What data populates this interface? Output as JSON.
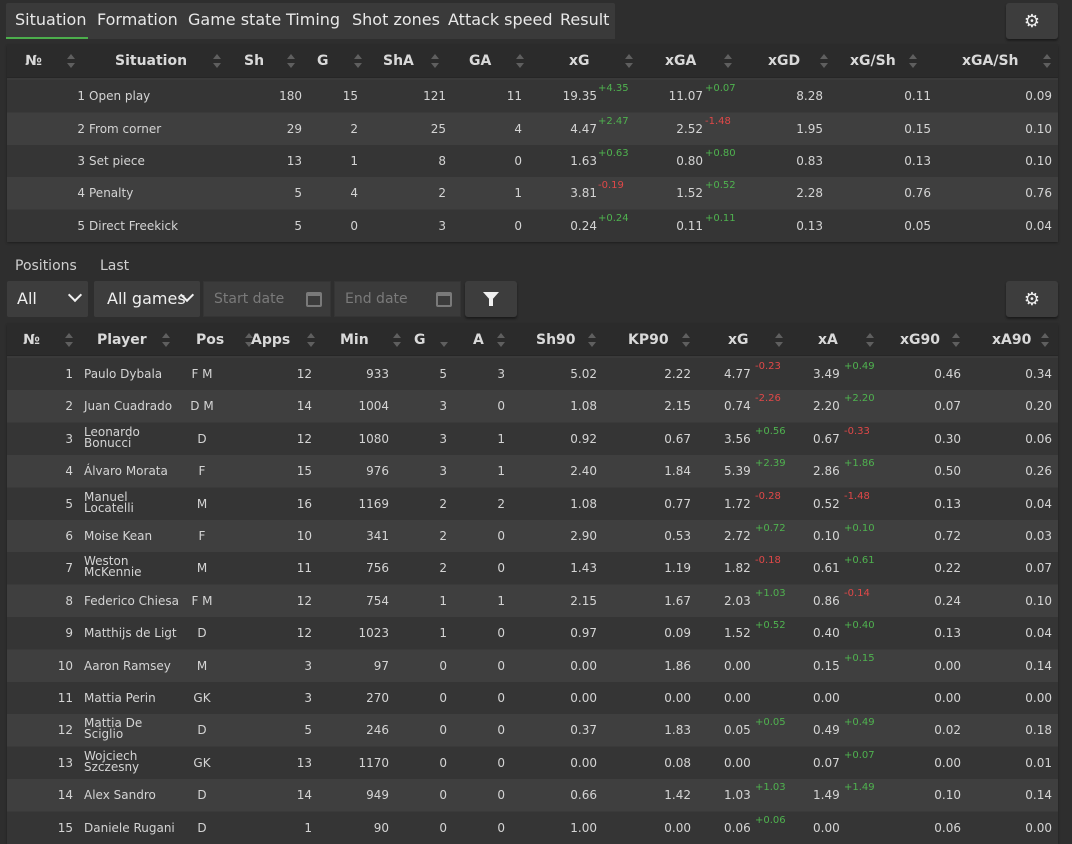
{
  "tabs": [
    "Situation",
    "Formation",
    "Game state",
    "Timing",
    "Shot zones",
    "Attack speed",
    "Result"
  ],
  "active_tab": "Situation",
  "situation_table": {
    "headers": [
      "№",
      "Situation",
      "Sh",
      "G",
      "ShA",
      "GA",
      "xG",
      "xGA",
      "xGD",
      "xG/Sh",
      "xGA/Sh"
    ],
    "rows": [
      {
        "n": "1",
        "situation": "Open play",
        "sh": "180",
        "g": "15",
        "sha": "121",
        "ga": "11",
        "xg": "19.35",
        "xg_diff": "+4.35",
        "xga": "11.07",
        "xga_diff": "+0.07",
        "xgd": "8.28",
        "xg_sh": "0.11",
        "xga_sh": "0.09"
      },
      {
        "n": "2",
        "situation": "From corner",
        "sh": "29",
        "g": "2",
        "sha": "25",
        "ga": "4",
        "xg": "4.47",
        "xg_diff": "+2.47",
        "xga": "2.52",
        "xga_diff": "-1.48",
        "xgd": "1.95",
        "xg_sh": "0.15",
        "xga_sh": "0.10"
      },
      {
        "n": "3",
        "situation": "Set piece",
        "sh": "13",
        "g": "1",
        "sha": "8",
        "ga": "0",
        "xg": "1.63",
        "xg_diff": "+0.63",
        "xga": "0.80",
        "xga_diff": "+0.80",
        "xgd": "0.83",
        "xg_sh": "0.13",
        "xga_sh": "0.10"
      },
      {
        "n": "4",
        "situation": "Penalty",
        "sh": "5",
        "g": "4",
        "sha": "2",
        "ga": "1",
        "xg": "3.81",
        "xg_diff": "-0.19",
        "xga": "1.52",
        "xga_diff": "+0.52",
        "xgd": "2.28",
        "xg_sh": "0.76",
        "xga_sh": "0.76"
      },
      {
        "n": "5",
        "situation": "Direct Freekick",
        "sh": "5",
        "g": "0",
        "sha": "3",
        "ga": "0",
        "xg": "0.24",
        "xg_diff": "+0.24",
        "xga": "0.11",
        "xga_diff": "+0.11",
        "xgd": "0.13",
        "xg_sh": "0.05",
        "xga_sh": "0.04"
      }
    ]
  },
  "filters": {
    "positions_label": "Positions",
    "last_label": "Last",
    "positions_value": "All",
    "last_value": "All games",
    "start_placeholder": "Start date",
    "end_placeholder": "End date"
  },
  "player_table": {
    "headers": [
      "№",
      "Player",
      "Pos",
      "Apps",
      "Min",
      "G",
      "A",
      "Sh90",
      "KP90",
      "xG",
      "xA",
      "xG90",
      "xA90"
    ],
    "rows": [
      {
        "n": "1",
        "name": "Paulo Dybala",
        "pos": "F M",
        "apps": "12",
        "min": "933",
        "g": "5",
        "a": "3",
        "sh90": "5.02",
        "kp90": "2.22",
        "xg": "4.77",
        "xg_diff": "-0.23",
        "xa": "3.49",
        "xa_diff": "+0.49",
        "xg90": "0.46",
        "xa90": "0.34"
      },
      {
        "n": "2",
        "name": "Juan Cuadrado",
        "pos": "D M",
        "apps": "14",
        "min": "1004",
        "g": "3",
        "a": "0",
        "sh90": "1.08",
        "kp90": "2.15",
        "xg": "0.74",
        "xg_diff": "-2.26",
        "xa": "2.20",
        "xa_diff": "+2.20",
        "xg90": "0.07",
        "xa90": "0.20"
      },
      {
        "n": "3",
        "name": "Leonardo Bonucci",
        "pos": "D",
        "apps": "12",
        "min": "1080",
        "g": "3",
        "a": "1",
        "sh90": "0.92",
        "kp90": "0.67",
        "xg": "3.56",
        "xg_diff": "+0.56",
        "xa": "0.67",
        "xa_diff": "-0.33",
        "xg90": "0.30",
        "xa90": "0.06"
      },
      {
        "n": "4",
        "name": "Álvaro Morata",
        "pos": "F",
        "apps": "15",
        "min": "976",
        "g": "3",
        "a": "1",
        "sh90": "2.40",
        "kp90": "1.84",
        "xg": "5.39",
        "xg_diff": "+2.39",
        "xa": "2.86",
        "xa_diff": "+1.86",
        "xg90": "0.50",
        "xa90": "0.26"
      },
      {
        "n": "5",
        "name": "Manuel Locatelli",
        "pos": "M",
        "apps": "16",
        "min": "1169",
        "g": "2",
        "a": "2",
        "sh90": "1.08",
        "kp90": "0.77",
        "xg": "1.72",
        "xg_diff": "-0.28",
        "xa": "0.52",
        "xa_diff": "-1.48",
        "xg90": "0.13",
        "xa90": "0.04"
      },
      {
        "n": "6",
        "name": "Moise Kean",
        "pos": "F",
        "apps": "10",
        "min": "341",
        "g": "2",
        "a": "0",
        "sh90": "2.90",
        "kp90": "0.53",
        "xg": "2.72",
        "xg_diff": "+0.72",
        "xa": "0.10",
        "xa_diff": "+0.10",
        "xg90": "0.72",
        "xa90": "0.03"
      },
      {
        "n": "7",
        "name": "Weston McKennie",
        "pos": "M",
        "apps": "11",
        "min": "756",
        "g": "2",
        "a": "0",
        "sh90": "1.43",
        "kp90": "1.19",
        "xg": "1.82",
        "xg_diff": "-0.18",
        "xa": "0.61",
        "xa_diff": "+0.61",
        "xg90": "0.22",
        "xa90": "0.07"
      },
      {
        "n": "8",
        "name": "Federico Chiesa",
        "pos": "F M",
        "apps": "12",
        "min": "754",
        "g": "1",
        "a": "1",
        "sh90": "2.15",
        "kp90": "1.67",
        "xg": "2.03",
        "xg_diff": "+1.03",
        "xa": "0.86",
        "xa_diff": "-0.14",
        "xg90": "0.24",
        "xa90": "0.10"
      },
      {
        "n": "9",
        "name": "Matthijs de Ligt",
        "pos": "D",
        "apps": "12",
        "min": "1023",
        "g": "1",
        "a": "0",
        "sh90": "0.97",
        "kp90": "0.09",
        "xg": "1.52",
        "xg_diff": "+0.52",
        "xa": "0.40",
        "xa_diff": "+0.40",
        "xg90": "0.13",
        "xa90": "0.04"
      },
      {
        "n": "10",
        "name": "Aaron Ramsey",
        "pos": "M",
        "apps": "3",
        "min": "97",
        "g": "0",
        "a": "0",
        "sh90": "0.00",
        "kp90": "1.86",
        "xg": "0.00",
        "xg_diff": "",
        "xa": "0.15",
        "xa_diff": "+0.15",
        "xg90": "0.00",
        "xa90": "0.14"
      },
      {
        "n": "11",
        "name": "Mattia Perin",
        "pos": "GK",
        "apps": "3",
        "min": "270",
        "g": "0",
        "a": "0",
        "sh90": "0.00",
        "kp90": "0.00",
        "xg": "0.00",
        "xg_diff": "",
        "xa": "0.00",
        "xa_diff": "",
        "xg90": "0.00",
        "xa90": "0.00"
      },
      {
        "n": "12",
        "name": "Mattia De Sciglio",
        "pos": "D",
        "apps": "5",
        "min": "246",
        "g": "0",
        "a": "0",
        "sh90": "0.37",
        "kp90": "1.83",
        "xg": "0.05",
        "xg_diff": "+0.05",
        "xa": "0.49",
        "xa_diff": "+0.49",
        "xg90": "0.02",
        "xa90": "0.18"
      },
      {
        "n": "13",
        "name": "Wojciech Szczesny",
        "pos": "GK",
        "apps": "13",
        "min": "1170",
        "g": "0",
        "a": "0",
        "sh90": "0.00",
        "kp90": "0.08",
        "xg": "0.00",
        "xg_diff": "",
        "xa": "0.07",
        "xa_diff": "+0.07",
        "xg90": "0.00",
        "xa90": "0.01"
      },
      {
        "n": "14",
        "name": "Alex Sandro",
        "pos": "D",
        "apps": "14",
        "min": "949",
        "g": "0",
        "a": "0",
        "sh90": "0.66",
        "kp90": "1.42",
        "xg": "1.03",
        "xg_diff": "+1.03",
        "xa": "1.49",
        "xa_diff": "+1.49",
        "xg90": "0.10",
        "xa90": "0.14"
      },
      {
        "n": "15",
        "name": "Daniele Rugani",
        "pos": "D",
        "apps": "1",
        "min": "90",
        "g": "0",
        "a": "0",
        "sh90": "1.00",
        "kp90": "0.00",
        "xg": "0.06",
        "xg_diff": "+0.06",
        "xa": "0.00",
        "xa_diff": "",
        "xg90": "0.06",
        "xa90": "0.00"
      }
    ]
  },
  "icons": {
    "settings": "gear-icon",
    "filter": "funnel-icon",
    "calendar": "calendar-icon",
    "dropdown": "chevron-down-icon",
    "sort": "sort-icon"
  },
  "colors": {
    "accent": "#4cae4c",
    "positive": "#4fb24f",
    "negative": "#e04848",
    "background": "#2e2e2e"
  }
}
